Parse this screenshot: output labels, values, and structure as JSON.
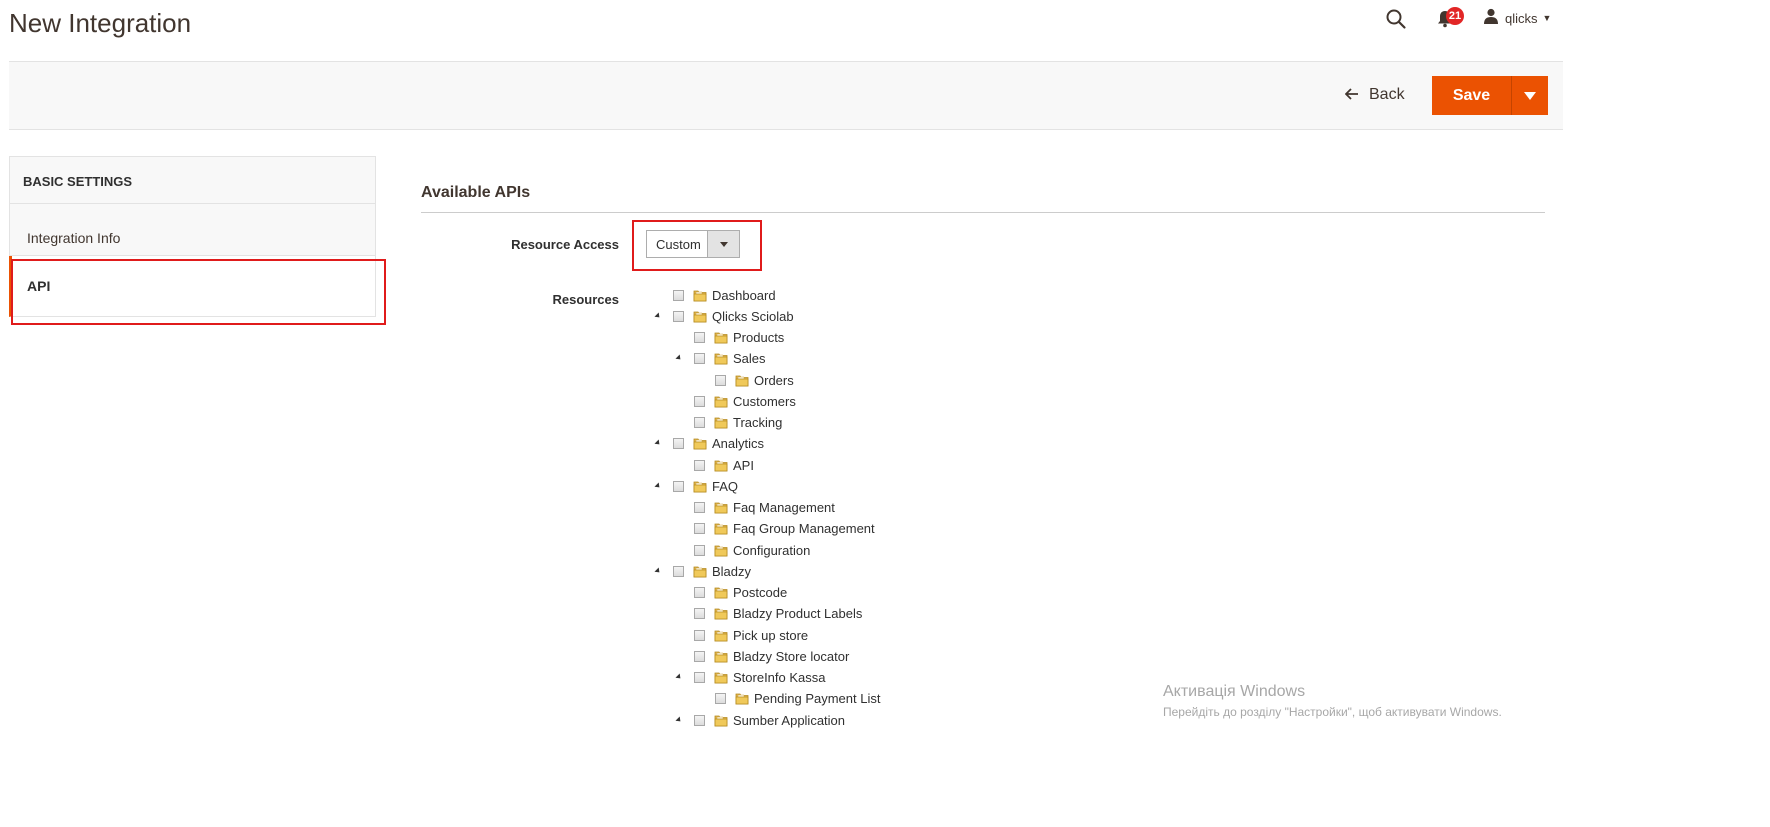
{
  "header": {
    "title": "New Integration",
    "notifications_count": "21",
    "user_name": "qlicks"
  },
  "actions": {
    "back_label": "Back",
    "save_label": "Save"
  },
  "sidebar": {
    "heading": "BASIC SETTINGS",
    "items": [
      {
        "label": "Integration Info"
      },
      {
        "label": "API"
      }
    ]
  },
  "main": {
    "section_title": "Available APIs",
    "resource_access_label": "Resource Access",
    "resource_access_value": "Custom",
    "resources_label": "Resources",
    "tree": [
      {
        "label": "Dashboard"
      },
      {
        "label": "Qlicks Sciolab"
      },
      {
        "label": "Products"
      },
      {
        "label": "Sales"
      },
      {
        "label": "Orders"
      },
      {
        "label": "Customers"
      },
      {
        "label": "Tracking"
      },
      {
        "label": "Analytics"
      },
      {
        "label": "API"
      },
      {
        "label": "FAQ"
      },
      {
        "label": "Faq Management"
      },
      {
        "label": "Faq Group Management"
      },
      {
        "label": "Configuration"
      },
      {
        "label": "Bladzy"
      },
      {
        "label": "Postcode"
      },
      {
        "label": "Bladzy Product Labels"
      },
      {
        "label": "Pick up store"
      },
      {
        "label": "Bladzy Store locator"
      },
      {
        "label": "StoreInfo Kassa"
      },
      {
        "label": "Pending Payment List"
      },
      {
        "label": "Sumber Application"
      }
    ]
  },
  "watermark": {
    "line1": "Активація Windows",
    "line2": "Перейдіть до розділу \"Настройки\", щоб активувати Windows."
  },
  "colors": {
    "accent": "#eb5202",
    "highlight_box": "#e01b1b",
    "badge": "#e22626"
  }
}
